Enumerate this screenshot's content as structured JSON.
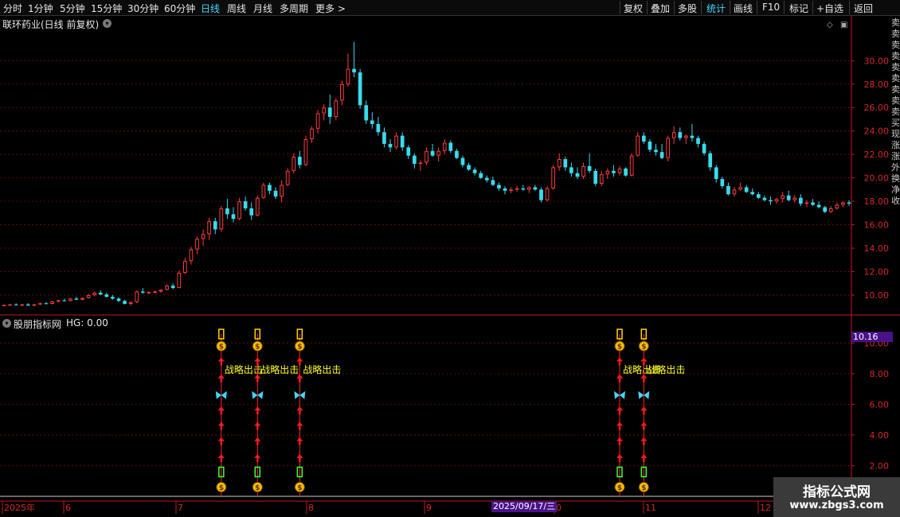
{
  "toolbar": {
    "periods": [
      "分时",
      "1分钟",
      "5分钟",
      "15分钟",
      "30分钟",
      "60分钟",
      "日线",
      "周线",
      "月线",
      "多周期",
      "更多 >"
    ],
    "active_period": "日线",
    "right_buttons": [
      "复权",
      "叠加",
      "多股",
      "统计",
      "画线",
      "F10",
      "标记",
      "+自选",
      "返回"
    ],
    "active_right": "统计"
  },
  "main_chart": {
    "stock_title": "联环药业(日线 前复权)",
    "y_ticks": [
      "30.00",
      "28.00",
      "26.00",
      "24.00",
      "22.00",
      "20.00",
      "18.00",
      "16.00",
      "14.00",
      "12.00",
      "10.00"
    ],
    "y_tick_values": [
      30,
      28,
      26,
      24,
      22,
      20,
      18,
      16,
      14,
      12,
      10
    ],
    "right_side_text": "卖卖卖卖卖卖卖卖卖买现涨涨外换净收"
  },
  "chart_data": [
    {
      "type": "candlestick",
      "title": "联环药业(日线 前复权)",
      "ylim": [
        8.3,
        32.6
      ],
      "colors": {
        "up": "#ff3b3b",
        "down": "#37dcef"
      },
      "note_series": "Daily OHLC, approximate from gridlines",
      "ohlc": [
        [
          9.1,
          9.2,
          9.05,
          9.15
        ],
        [
          9.15,
          9.25,
          9.1,
          9.2
        ],
        [
          9.2,
          9.3,
          9.1,
          9.15
        ],
        [
          9.15,
          9.25,
          9.05,
          9.2
        ],
        [
          9.2,
          9.3,
          9.1,
          9.1
        ],
        [
          9.1,
          9.25,
          9.05,
          9.2
        ],
        [
          9.2,
          9.35,
          9.15,
          9.3
        ],
        [
          9.3,
          9.4,
          9.2,
          9.25
        ],
        [
          9.25,
          9.5,
          9.2,
          9.45
        ],
        [
          9.45,
          9.6,
          9.35,
          9.55
        ],
        [
          9.55,
          9.7,
          9.45,
          9.5
        ],
        [
          9.5,
          9.75,
          9.45,
          9.7
        ],
        [
          9.7,
          9.85,
          9.6,
          9.6
        ],
        [
          9.6,
          9.8,
          9.55,
          9.75
        ],
        [
          9.75,
          10.1,
          9.7,
          10.0
        ],
        [
          10.0,
          10.3,
          9.9,
          10.2
        ],
        [
          10.2,
          10.4,
          10.0,
          10.05
        ],
        [
          10.05,
          10.2,
          9.8,
          9.85
        ],
        [
          9.85,
          10.0,
          9.6,
          9.7
        ],
        [
          9.7,
          9.8,
          9.4,
          9.5
        ],
        [
          9.5,
          9.6,
          9.2,
          9.25
        ],
        [
          9.25,
          9.45,
          9.1,
          9.4
        ],
        [
          9.4,
          10.4,
          9.3,
          10.3
        ],
        [
          10.3,
          10.6,
          10.1,
          10.2
        ],
        [
          10.2,
          10.35,
          10.1,
          10.25
        ],
        [
          10.25,
          10.4,
          10.15,
          10.3
        ],
        [
          10.3,
          10.5,
          10.2,
          10.45
        ],
        [
          10.45,
          10.9,
          10.4,
          10.8
        ],
        [
          10.8,
          11.0,
          10.5,
          10.6
        ],
        [
          10.6,
          12.1,
          10.6,
          11.9
        ],
        [
          11.9,
          13.2,
          11.8,
          12.9
        ],
        [
          12.9,
          14.1,
          12.6,
          13.9
        ],
        [
          13.9,
          15.0,
          13.5,
          14.8
        ],
        [
          14.8,
          15.6,
          14.2,
          15.2
        ],
        [
          15.2,
          16.6,
          14.7,
          16.3
        ],
        [
          16.3,
          16.6,
          15.2,
          15.6
        ],
        [
          15.6,
          17.6,
          15.4,
          17.4
        ],
        [
          17.4,
          18.2,
          16.5,
          16.9
        ],
        [
          16.9,
          17.5,
          16.2,
          16.5
        ],
        [
          16.5,
          18.3,
          16.4,
          18.0
        ],
        [
          18.0,
          18.4,
          17.2,
          17.4
        ],
        [
          17.4,
          17.9,
          16.4,
          16.8
        ],
        [
          16.8,
          18.5,
          16.7,
          18.3
        ],
        [
          18.3,
          19.6,
          18.2,
          19.4
        ],
        [
          19.4,
          19.6,
          18.6,
          18.9
        ],
        [
          18.9,
          19.2,
          18.2,
          18.4
        ],
        [
          18.4,
          19.8,
          17.9,
          19.4
        ],
        [
          19.4,
          20.8,
          19.3,
          20.6
        ],
        [
          20.6,
          22.1,
          20.4,
          21.8
        ],
        [
          21.8,
          22.3,
          20.8,
          21.1
        ],
        [
          21.1,
          23.6,
          21.0,
          23.3
        ],
        [
          23.3,
          24.4,
          23.0,
          24.2
        ],
        [
          24.2,
          25.8,
          23.8,
          25.5
        ],
        [
          25.5,
          26.3,
          24.9,
          26.0
        ],
        [
          26.0,
          27.1,
          24.6,
          25.2
        ],
        [
          25.2,
          26.8,
          24.9,
          26.6
        ],
        [
          26.6,
          28.3,
          26.2,
          28.0
        ],
        [
          28.0,
          30.6,
          27.8,
          29.3
        ],
        [
          29.3,
          31.6,
          28.6,
          29.0
        ],
        [
          29.0,
          29.3,
          25.9,
          26.2
        ],
        [
          26.2,
          26.6,
          24.6,
          24.9
        ],
        [
          24.9,
          25.6,
          24.2,
          24.6
        ],
        [
          24.6,
          25.2,
          23.6,
          23.9
        ],
        [
          23.9,
          24.3,
          22.6,
          22.9
        ],
        [
          22.9,
          23.3,
          22.2,
          22.6
        ],
        [
          22.6,
          23.9,
          22.4,
          23.6
        ],
        [
          23.6,
          23.9,
          22.3,
          22.6
        ],
        [
          22.6,
          22.8,
          21.6,
          21.9
        ],
        [
          21.9,
          22.1,
          20.8,
          21.2
        ],
        [
          21.2,
          21.5,
          20.6,
          21.3
        ],
        [
          21.3,
          22.6,
          21.1,
          22.3
        ],
        [
          22.3,
          22.9,
          21.8,
          21.9
        ],
        [
          21.9,
          22.6,
          21.4,
          22.3
        ],
        [
          22.3,
          23.3,
          22.0,
          23.0
        ],
        [
          23.0,
          23.2,
          22.1,
          22.3
        ],
        [
          22.3,
          22.5,
          21.6,
          21.7
        ],
        [
          21.7,
          21.9,
          20.9,
          21.1
        ],
        [
          21.1,
          21.3,
          20.6,
          20.7
        ],
        [
          20.7,
          20.9,
          20.2,
          20.4
        ],
        [
          20.4,
          20.6,
          19.9,
          20.0
        ],
        [
          20.0,
          20.2,
          19.6,
          19.8
        ],
        [
          19.8,
          20.1,
          19.3,
          19.4
        ],
        [
          19.4,
          19.6,
          18.9,
          19.1
        ],
        [
          19.1,
          19.3,
          18.6,
          18.9
        ],
        [
          18.9,
          19.2,
          18.7,
          19.0
        ],
        [
          19.0,
          19.3,
          18.8,
          19.1
        ],
        [
          19.1,
          19.4,
          18.9,
          19.0
        ],
        [
          19.0,
          19.3,
          18.7,
          19.2
        ],
        [
          19.2,
          19.4,
          18.9,
          19.0
        ],
        [
          19.0,
          19.2,
          17.9,
          18.1
        ],
        [
          18.1,
          19.3,
          18.0,
          19.1
        ],
        [
          19.1,
          21.1,
          19.0,
          20.9
        ],
        [
          20.9,
          22.1,
          20.6,
          21.6
        ],
        [
          21.6,
          21.8,
          20.6,
          20.9
        ],
        [
          20.9,
          21.3,
          20.1,
          20.4
        ],
        [
          20.4,
          20.9,
          19.9,
          20.1
        ],
        [
          20.1,
          21.3,
          19.9,
          21.0
        ],
        [
          21.0,
          22.1,
          20.4,
          20.6
        ],
        [
          20.6,
          20.8,
          19.3,
          19.5
        ],
        [
          19.5,
          20.6,
          19.3,
          20.3
        ],
        [
          20.3,
          20.8,
          19.9,
          20.6
        ],
        [
          20.6,
          21.1,
          20.1,
          20.4
        ],
        [
          20.4,
          21.0,
          20.2,
          20.8
        ],
        [
          20.8,
          20.9,
          20.1,
          20.2
        ],
        [
          20.2,
          22.1,
          20.1,
          21.9
        ],
        [
          21.9,
          23.9,
          21.8,
          23.6
        ],
        [
          23.6,
          23.9,
          22.9,
          23.1
        ],
        [
          23.1,
          23.3,
          22.2,
          22.4
        ],
        [
          22.4,
          22.9,
          21.9,
          22.2
        ],
        [
          22.2,
          22.9,
          21.6,
          21.7
        ],
        [
          21.7,
          23.6,
          21.4,
          23.4
        ],
        [
          23.4,
          24.4,
          22.9,
          23.9
        ],
        [
          23.9,
          24.3,
          23.2,
          23.4
        ],
        [
          23.4,
          23.7,
          22.9,
          23.6
        ],
        [
          23.6,
          24.6,
          23.1,
          23.4
        ],
        [
          23.4,
          23.6,
          22.6,
          22.9
        ],
        [
          22.9,
          23.1,
          21.9,
          22.1
        ],
        [
          22.1,
          22.3,
          20.6,
          20.9
        ],
        [
          20.9,
          21.1,
          19.6,
          19.9
        ],
        [
          19.9,
          20.1,
          19.1,
          19.3
        ],
        [
          19.3,
          19.6,
          18.5,
          18.6
        ],
        [
          18.6,
          19.2,
          18.4,
          19.0
        ],
        [
          19.0,
          19.6,
          18.9,
          19.2
        ],
        [
          19.2,
          19.4,
          18.7,
          18.8
        ],
        [
          18.8,
          19.1,
          18.5,
          18.6
        ],
        [
          18.6,
          18.8,
          18.2,
          18.3
        ],
        [
          18.3,
          18.5,
          18.0,
          18.1
        ],
        [
          18.1,
          18.4,
          17.7,
          18.0
        ],
        [
          18.0,
          18.3,
          17.8,
          18.2
        ],
        [
          18.2,
          18.8,
          17.9,
          18.5
        ],
        [
          18.5,
          18.9,
          18.0,
          18.1
        ],
        [
          18.1,
          18.5,
          17.9,
          18.3
        ],
        [
          18.3,
          18.6,
          17.6,
          17.8
        ],
        [
          17.8,
          18.1,
          17.5,
          17.9
        ],
        [
          17.9,
          18.2,
          17.6,
          17.7
        ],
        [
          17.7,
          18.0,
          17.4,
          17.5
        ],
        [
          17.5,
          17.6,
          17.0,
          17.1
        ],
        [
          17.1,
          17.6,
          17.0,
          17.4
        ],
        [
          17.4,
          17.9,
          17.3,
          17.7
        ],
        [
          17.7,
          18.0,
          17.5,
          17.9
        ],
        [
          17.9,
          18.1,
          17.6,
          17.8
        ]
      ]
    },
    {
      "type": "signal",
      "title": "股朋指标网 HG: 0.00",
      "ylim": [
        0,
        11
      ],
      "y_ticks": [
        "10.00",
        "8.00",
        "6.00",
        "4.00",
        "2.00"
      ],
      "y_tick_values": [
        10,
        8,
        6,
        4,
        2
      ],
      "last_value": "10.16",
      "signal_text": "战略出击",
      "signal_bars": [
        36,
        42,
        49,
        102,
        106
      ]
    }
  ],
  "indicator_panel": {
    "title": "股朋指标网",
    "hg_label": "HG: 0.00"
  },
  "x_axis": {
    "labels": [
      "2025年",
      "6",
      "7",
      "8",
      "9",
      "0",
      "11",
      "12"
    ],
    "cursor_label": "2025/09/17/三"
  },
  "watermark": {
    "cn": "指标公式网",
    "url": "www.zbgs3.com"
  },
  "colors": {
    "up": "#ff3b3b",
    "down": "#37dcef",
    "grid": "#5a0d0d",
    "axis": "#c8141e",
    "tick_text": "#d22828",
    "signal_text": "#ffff28",
    "accent": "#3fd8ff"
  }
}
